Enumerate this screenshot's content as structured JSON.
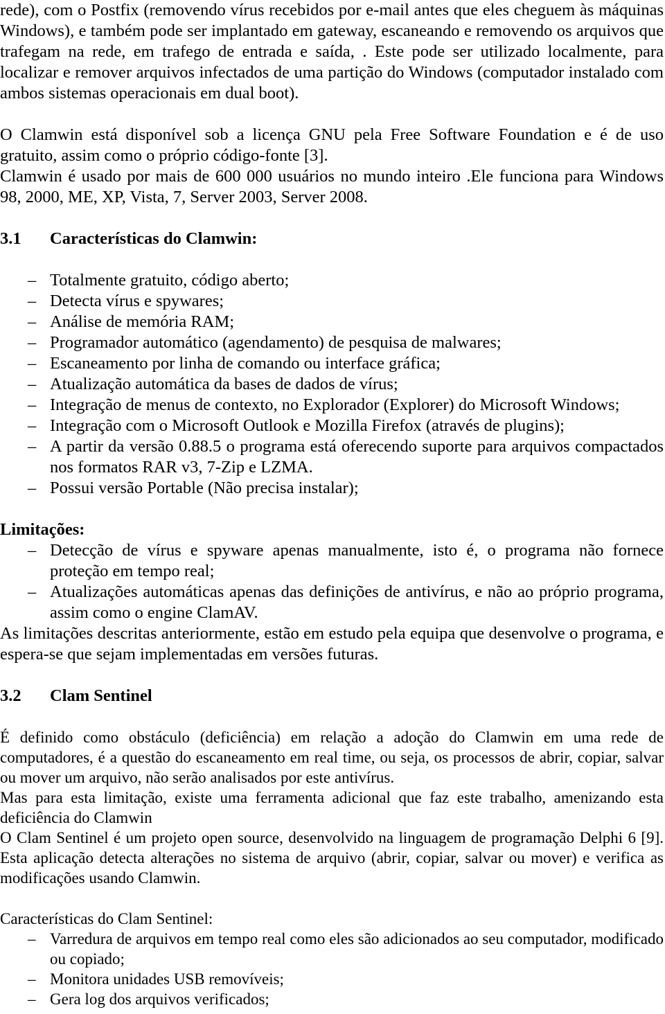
{
  "document": {
    "language": "pt-BR",
    "body_text_color": "#000000",
    "background_color": "#ffffff"
  },
  "paragraphs": {
    "intro": "rede), com o Postfix (removendo vírus recebidos por e-mail antes que eles cheguem às máquinas Windows), e também pode ser implantado em gateway, escaneando e removendo os arquivos que trafegam na rede, em trafego de entrada e saída, . Este pode ser utilizado localmente, para localizar e remover arquivos infectados de uma partição do Windows (computador instalado com ambos sistemas operacionais em dual boot).",
    "license": "O Clamwin está disponível sob a licença GNU pela Free Software Foundation e é de uso gratuito, assim como o próprio código-fonte [3].",
    "users": "Clamwin é usado por mais de 600 000 usuários no mundo inteiro .Ele funciona para Windows 98, 2000, ME, XP, Vista, 7, Server 2003, Server 2008.",
    "limitations_note": "As limitações descritas anteriormente, estão em estudo pela equipa que desenvolve o programa, e espera-se que sejam implementadas em versões futuras.",
    "sentinel_def": "É definido como obstáculo (deficiência) em relação a adoção do Clamwin em uma rede de computadores, é a questão do escaneamento em real time, ou seja, os processos de abrir, copiar, salvar ou mover um arquivo, não serão analisados por este antivírus.",
    "sentinel_tool": "Mas para esta limitação, existe uma ferramenta adicional que faz este trabalho, amenizando esta deficiência do Clamwin",
    "sentinel_project": "O Clam Sentinel é um projeto open source, desenvolvido na linguagem de programação Delphi 6 [9]. Esta aplicação detecta alterações no sistema de arquivo (abrir, copiar, salvar ou mover) e verifica as modificações usando Clamwin."
  },
  "sections": {
    "clamwin_features": {
      "number": "3.1",
      "title": "Características do Clamwin:",
      "items": [
        "Totalmente gratuito, código aberto;",
        "Detecta vírus e spywares;",
        "Análise de memória RAM;",
        "Programador automático (agendamento) de pesquisa de malwares;",
        "Escaneamento por linha de comando ou interface gráfica;",
        "Atualização automática da bases de dados de vírus;",
        "Integração de menus de contexto, no Explorador (Explorer) do Microsoft Windows;",
        "Integração com o Microsoft Outlook e  Mozilla Firefox (através de plugins);",
        "A partir da versão 0.88.5 o programa está oferecendo suporte para arquivos compactados nos formatos RAR v3, 7-Zip e LZMA.",
        "Possui versão Portable (Não precisa instalar);"
      ],
      "multiline_flags": [
        false,
        false,
        false,
        false,
        false,
        false,
        false,
        false,
        true,
        false
      ]
    },
    "limitations": {
      "title": "Limitações:",
      "items": [
        "Detecção de vírus e spyware apenas manualmente, isto é, o programa não fornece proteção em tempo real;",
        "Atualizações automáticas apenas das definições de antivírus, e não ao próprio programa, assim como o engine ClamAV."
      ]
    },
    "clam_sentinel": {
      "number": "3.2",
      "title": "Clam Sentinel"
    },
    "sentinel_features": {
      "title": "Características do Clam Sentinel:",
      "items": [
        "Varredura de arquivos em tempo real como eles são adicionados ao seu computador, modificado ou copiado;",
        "Monitora unidades USB removíveis;",
        "Gera log dos arquivos verificados;"
      ]
    }
  },
  "bullet_marker": "–"
}
